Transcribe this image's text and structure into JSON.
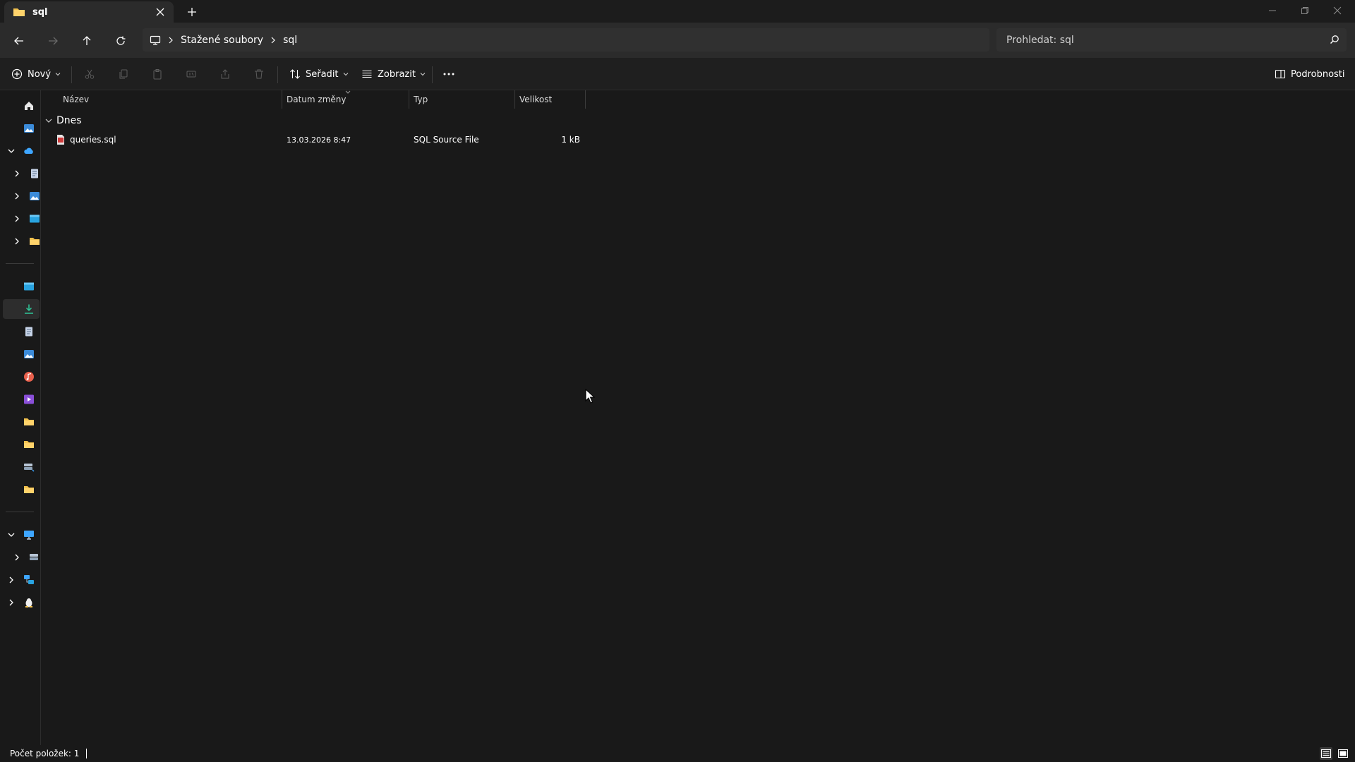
{
  "window": {
    "tab_title": "sql"
  },
  "address": {
    "breadcrumbs": [
      "Stažené soubory",
      "sql"
    ],
    "search_placeholder": "Prohledat: sql"
  },
  "toolbar": {
    "new_label": "Nový",
    "sort_label": "Seřadit",
    "view_label": "Zobrazit",
    "details_label": "Podrobnosti"
  },
  "columns": {
    "name": "Název",
    "date": "Datum změny",
    "type": "Typ",
    "size": "Velikost"
  },
  "group": {
    "label": "Dnes"
  },
  "files": [
    {
      "name": "queries.sql",
      "date": "13.03.2026 8:47",
      "type": "SQL Source File",
      "size": "1 kB"
    }
  ],
  "status": {
    "item_count": "Počet položek: 1"
  },
  "colors": {
    "accent": "#4cc2ff",
    "folder": "#f2c14e",
    "background": "#191919"
  }
}
